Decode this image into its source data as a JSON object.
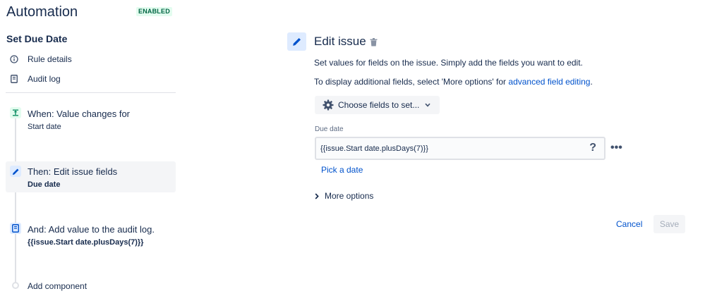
{
  "header": {
    "title": "Automation",
    "status_badge": "ENABLED"
  },
  "rule": {
    "name": "Set Due Date",
    "nav": [
      {
        "label": "Rule details",
        "icon": "info-icon"
      },
      {
        "label": "Audit log",
        "icon": "document-icon"
      }
    ]
  },
  "components": [
    {
      "title": "When: Value changes for",
      "subtitle": "Start date",
      "icon": "trigger-icon"
    },
    {
      "title": "Then: Edit issue fields",
      "subtitle": "Due date",
      "icon": "pencil-icon"
    },
    {
      "title": "And: Add value to the audit log.",
      "subtitle": "{{issue.Start date.plusDays(7)}}",
      "icon": "log-icon"
    }
  ],
  "add_component_label": "Add component",
  "action": {
    "title": "Edit issue",
    "description_1": "Set values for fields on the issue. Simply add the fields you want to edit.",
    "description_2_prefix": "To display additional fields, select 'More options' for ",
    "description_2_link": "advanced field editing",
    "description_2_suffix": ".",
    "choose_fields_label": "Choose fields to set...",
    "field_label": "Due date",
    "field_value": "{{issue.Start date.plusDays(7)}}",
    "help_glyph": "?",
    "more_glyph": "•••",
    "pick_date_label": "Pick a date",
    "more_options_label": "More options",
    "cancel_label": "Cancel",
    "save_label": "Save"
  },
  "colors": {
    "brand_blue": "#0052cc",
    "enabled_bg": "#e3fcef",
    "enabled_text": "#006644",
    "trigger_green": "#00875a",
    "selected_bg": "#f4f5f7"
  }
}
